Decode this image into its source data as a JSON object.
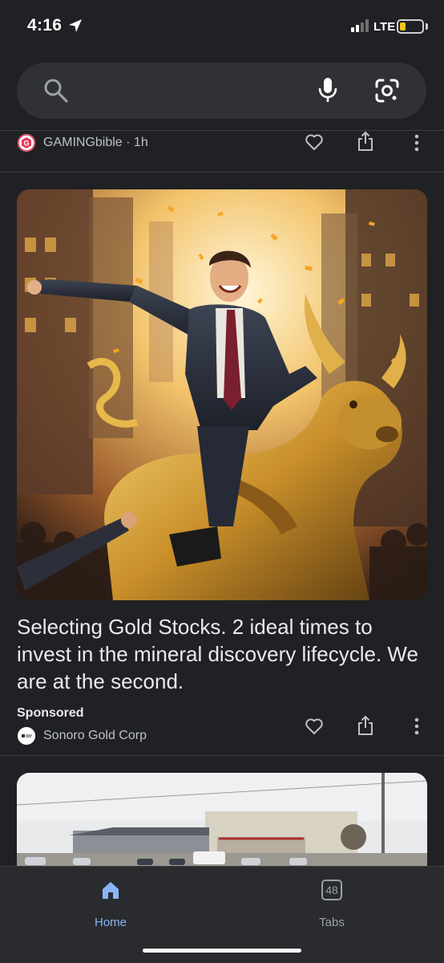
{
  "status_bar": {
    "time": "4:16",
    "network": "LTE",
    "battery_level": 0.25,
    "battery_color": "#f5c518",
    "icons": [
      "location-arrow-icon",
      "signal-icon",
      "battery-icon"
    ]
  },
  "search": {
    "placeholder": "",
    "icons": [
      "search-icon",
      "mic-icon",
      "google-lens-icon"
    ]
  },
  "feed": {
    "previous_card": {
      "source": "GAMINGbible · 1h",
      "logo_icon": "gamingbible-logo-icon",
      "actions": [
        "heart-icon",
        "share-icon",
        "more-vert-icon"
      ]
    },
    "sponsored_card": {
      "image_alt": "businessman-riding-golden-bull-illustration",
      "headline": "Selecting Gold Stocks. 2 ideal times to invest in the mineral discovery lifecycle. We are at the second.",
      "label": "Sponsored",
      "advertiser": "Sonoro Gold Corp",
      "logo_icon": "sonoro-logo-icon",
      "actions": [
        "heart-icon",
        "share-icon",
        "more-vert-icon"
      ]
    },
    "next_card": {
      "image_alt": "industrial-building-parking-lot-photo"
    }
  },
  "bottom_nav": {
    "home_label": "Home",
    "tabs_label": "Tabs",
    "tabs_count": "48",
    "active_color": "#8ab4f8",
    "inactive_color": "#9aa0a6"
  }
}
